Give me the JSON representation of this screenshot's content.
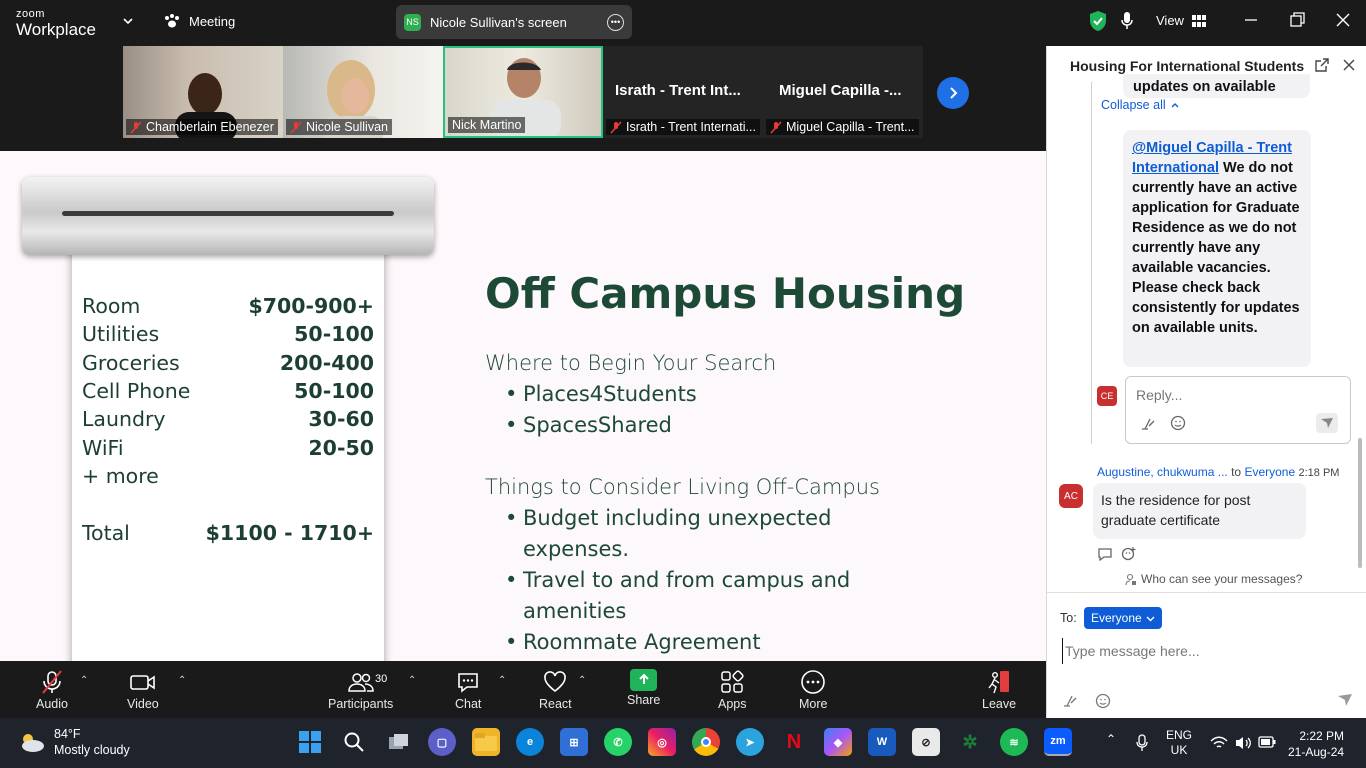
{
  "topbar": {
    "brand_top": "zoom",
    "brand_bottom": "Workplace",
    "meeting_label": "Meeting",
    "screen_share_initials": "NS",
    "screen_share_label": "Nicole Sullivan's screen",
    "view_label": "View"
  },
  "gallery": {
    "tiles": [
      {
        "name": "Chamberlain Ebenezer",
        "muted": true
      },
      {
        "name": "Nicole Sullivan",
        "muted": true
      },
      {
        "name": "Nick Martino",
        "muted": false
      },
      {
        "name": "Israth - Trent Internati...",
        "display": "Israth - Trent Int...",
        "muted": true
      },
      {
        "name": "Miguel Capilla - Trent...",
        "display": "Miguel Capilla -...",
        "muted": true
      }
    ]
  },
  "slide": {
    "title": "Off Campus Housing",
    "receipt": [
      {
        "item": "Room",
        "cost": "$700-900+"
      },
      {
        "item": "Utilities",
        "cost": "50-100"
      },
      {
        "item": "Groceries",
        "cost": "200-400"
      },
      {
        "item": "Cell Phone",
        "cost": "50-100"
      },
      {
        "item": "Laundry",
        "cost": "30-60"
      },
      {
        "item": "WiFi",
        "cost": "20-50"
      },
      {
        "item": "+ more",
        "cost": ""
      }
    ],
    "total_label": "Total",
    "total_value": "$1100 - 1710+",
    "section1": "Where to Begin Your Search",
    "bullets1": [
      "Places4Students",
      "SpacesShared"
    ],
    "section2": "Things to Consider Living Off-Campus",
    "bullets2": [
      {
        "line1": "Budget including unexpected",
        "line2": "expenses."
      },
      {
        "line1": "Travel to and from campus and",
        "line2": "amenities"
      },
      {
        "line1": "Roommate Agreement",
        "line2": ""
      }
    ]
  },
  "toolbar": {
    "audio": "Audio",
    "video": "Video",
    "participants": "Participants",
    "participants_count": "30",
    "chat": "Chat",
    "react": "React",
    "share": "Share",
    "apps": "Apps",
    "more": "More",
    "leave": "Leave"
  },
  "chat": {
    "title": "Housing For International Students",
    "clipped_text": "updates on available",
    "collapse_label": "Collapse all",
    "reply_mention": "@Miguel Capilla - Trent International",
    "reply_text": " We do not currently have an active application for Graduate Residence as we do not currently have any available vacancies. Please check back consistently for updates on available units.",
    "reply_avatar": "CE",
    "reply_placeholder": "Reply...",
    "sender_name": "Augustine, chukwuma ...",
    "sender_to": "to",
    "sender_target": "Everyone",
    "sender_time": "2:18 PM",
    "sender_avatar": "AC",
    "message": "Is the residence for post graduate certificate",
    "visibility": "Who can see your messages?",
    "to_label": "To:",
    "to_value": "Everyone",
    "input_placeholder": "Type message here..."
  },
  "taskbar": {
    "temp": "84°F",
    "condition": "Mostly cloudy",
    "lang1": "ENG",
    "lang2": "UK",
    "time": "2:22 PM",
    "date": "21-Aug-24"
  },
  "colors": {
    "accent": "#0e5cd6",
    "slide_text": "#1d4937",
    "active_border": "#26c281",
    "share_green": "#1fb35a"
  }
}
